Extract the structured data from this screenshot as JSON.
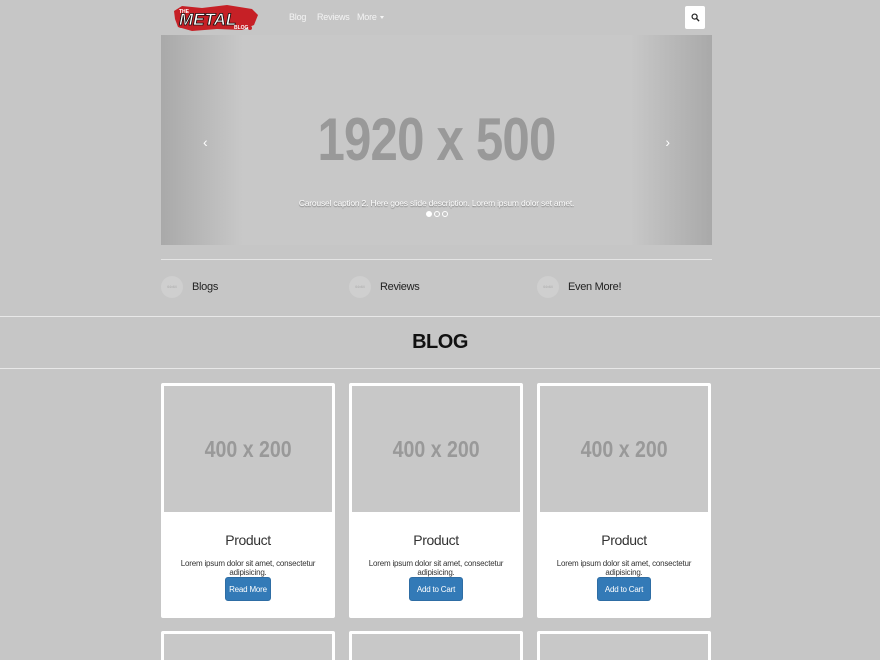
{
  "navbar": {
    "logo": {
      "small_top": "THE",
      "main": "METAL",
      "small_bottom": "BLOG"
    },
    "links": {
      "blog": "Blog",
      "reviews": "Reviews",
      "more": "More"
    },
    "search_icon": "search-icon"
  },
  "carousel": {
    "placeholder_text": "1920 x 500",
    "prev": "‹",
    "next": "›",
    "caption": "Carousel caption 2. Here goes slide description. Lorem ipsum dolor set amet.",
    "slide_count": 3,
    "active_slide": 1
  },
  "features": [
    {
      "icon_text": "64x64",
      "label": "Blogs"
    },
    {
      "icon_text": "64x64",
      "label": "Reviews"
    },
    {
      "icon_text": "64x64",
      "label": "Even More!"
    }
  ],
  "blog": {
    "title": "BLOG"
  },
  "cards": [
    {
      "image_text": "400 x 200",
      "title": "Product",
      "text": "Lorem ipsum dolor sit amet, consectetur adipisicing.",
      "button": "Read More"
    },
    {
      "image_text": "400 x 200",
      "title": "Product",
      "text": "Lorem ipsum dolor sit amet, consectetur adipisicing.",
      "button": " Add to Cart"
    },
    {
      "image_text": "400 x 200",
      "title": "Product",
      "text": "Lorem ipsum dolor sit amet, consectetur adipisicing.",
      "button": " Add to Cart"
    }
  ],
  "colors": {
    "background": "#c6c6c6",
    "primary_button": "#337ab7",
    "logo_red": "#c62026"
  }
}
